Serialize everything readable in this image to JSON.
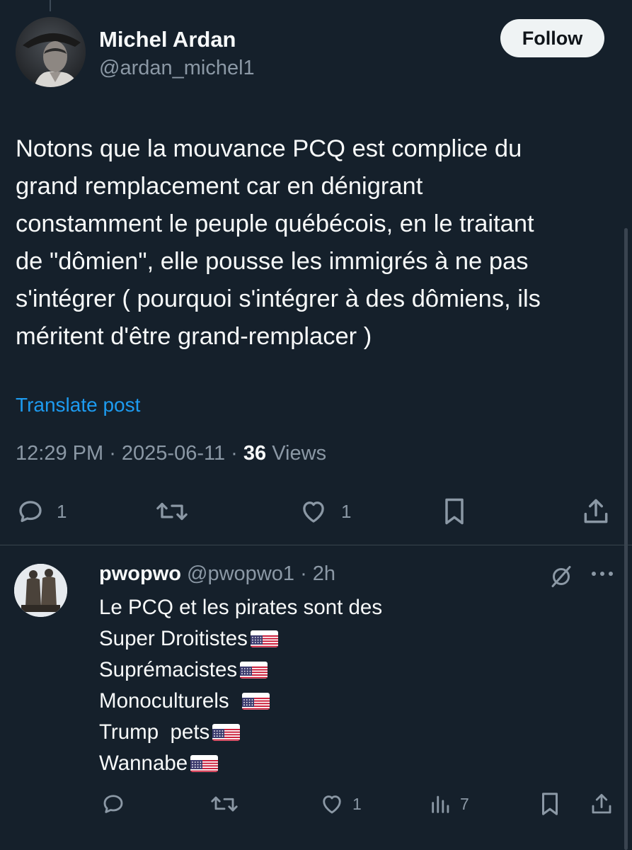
{
  "main_post": {
    "author_name": "Michel Ardan",
    "author_handle": "@ardan_michel1",
    "follow_label": "Follow",
    "text_lines": [
      "Notons que la mouvance PCQ est complice du",
      "grand remplacement car en dénigrant",
      "constamment le peuple québécois, en le traitant",
      "de \"dômien\", elle pousse les immigrés à ne pas",
      "s'intégrer ( pourquoi s'intégrer à des dômiens, ils",
      "méritent d'être grand-remplacer )"
    ],
    "translate_label": "Translate post",
    "time": "12:29 PM",
    "separator": " · ",
    "date": "2025-06-11",
    "views_count": "36",
    "views_label": "Views",
    "actions": {
      "reply_count": "1",
      "repost_count": "",
      "like_count": "1",
      "reply_icon": "reply-icon",
      "repost_icon": "repost-icon",
      "like_icon": "heart-icon",
      "bookmark_icon": "bookmark-icon",
      "share_icon": "share-icon"
    }
  },
  "reply": {
    "author_name": "pwopwo",
    "author_handle": "@pwopwo1",
    "separator": " · ",
    "time_ago": "2h",
    "lines": [
      {
        "text": "Le PCQ et les pirates sont des",
        "flag": false
      },
      {
        "text": "Super Droitistes",
        "flag": true
      },
      {
        "text": "Suprémacistes",
        "flag": true
      },
      {
        "text": "Monoculturels ",
        "flag": true
      },
      {
        "text": "Trump  pets",
        "flag": true
      },
      {
        "text": "Wannabe",
        "flag": true
      }
    ],
    "actions": {
      "reply_count": "",
      "repost_count": "",
      "like_count": "1",
      "views_count": "7"
    }
  },
  "colors": {
    "background": "#15202b",
    "accent": "#1d9bf0",
    "muted": "#8b98a5",
    "text": "#f7f9f9"
  }
}
